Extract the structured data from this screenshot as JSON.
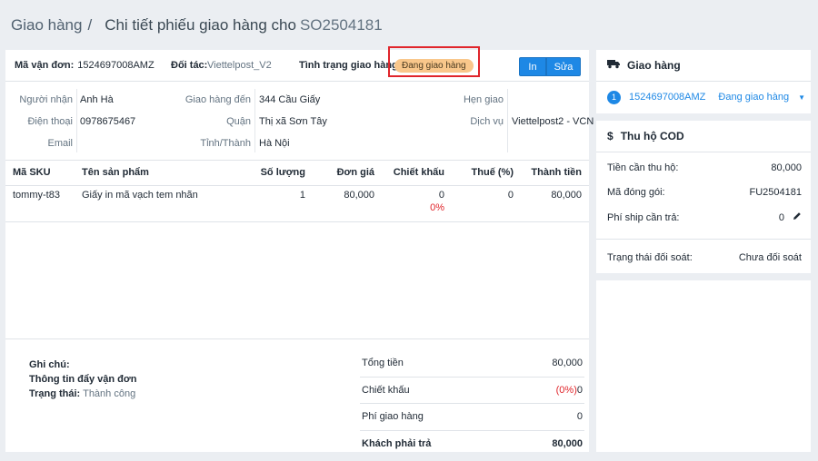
{
  "header": {
    "crumb": "Giao hàng",
    "sep": "/",
    "title": "Chi tiết phiếu giao hàng cho",
    "code": "SO2504181"
  },
  "topbar": {
    "waybill_label": "Mã vận đơn:",
    "waybill_value": "1524697008AMZ",
    "partner_label": "Đối tác:",
    "partner_value": "Viettelpost_V2",
    "status_label": "Tình trạng giao hàng",
    "status_value": "Đang giao hàng",
    "print_label": "In",
    "edit_label": "Sửa"
  },
  "info": {
    "recipient_label": "Người nhận",
    "recipient_value": "Anh Hà",
    "phone_label": "Điện thoại",
    "phone_value": "0978675467",
    "email_label": "Email",
    "email_value": "",
    "address_label": "Giao hàng đến",
    "address_value": "344 Cầu Giấy",
    "district_label": "Quận",
    "district_value": "Thị xã Sơn Tây",
    "province_label": "Tỉnh/Thành",
    "province_value": "Hà Nội",
    "appointment_label": "Hẹn giao",
    "appointment_value": "",
    "service_label": "Dịch vụ",
    "service_value": "Viettelpost2 - VCN"
  },
  "table": {
    "headers": [
      "Mã SKU",
      "Tên sản phẩm",
      "Số lượng",
      "Đơn giá",
      "Chiết khấu",
      "Thuế (%)",
      "Thành tiền"
    ],
    "rows": [
      {
        "sku": "tommy-t83",
        "name": "Giấy in mã vạch tem nhãn",
        "qty": "1",
        "price": "80,000",
        "discount": "0",
        "discount_pct": "0%",
        "tax": "0",
        "total": "80,000"
      }
    ]
  },
  "notes": {
    "note_label": "Ghi chú:",
    "push_label": "Thông tin đẩy vận đơn",
    "state_label": "Trạng thái:",
    "state_value": "Thành công"
  },
  "summary": {
    "total_label": "Tổng tiền",
    "total_value": "80,000",
    "discount_label": "Chiết khấu",
    "discount_pct": "(0%)",
    "discount_value": "0",
    "ship_label": "Phí giao hàng",
    "ship_value": "0",
    "customer_label": "Khách phải trả",
    "customer_value": "80,000"
  },
  "shipping_card": {
    "title": "Giao hàng",
    "step": "1",
    "waybill": "1524697008AMZ",
    "status": "Đang giao hàng"
  },
  "cod_card": {
    "title": "Thu hộ COD",
    "collect_label": "Tiền cần thu hộ:",
    "collect_value": "80,000",
    "package_label": "Mã đóng gói:",
    "package_value": "FU2504181",
    "shipfee_label": "Phí ship cần trả:",
    "shipfee_value": "0",
    "reconcile_label": "Trạng thái đối soát:",
    "reconcile_value": "Chưa đối soát"
  },
  "colors": {
    "accent": "#1e88e5",
    "badge": "#f9c78b",
    "highlight": "#e0252b",
    "background": "#ebeef2"
  }
}
